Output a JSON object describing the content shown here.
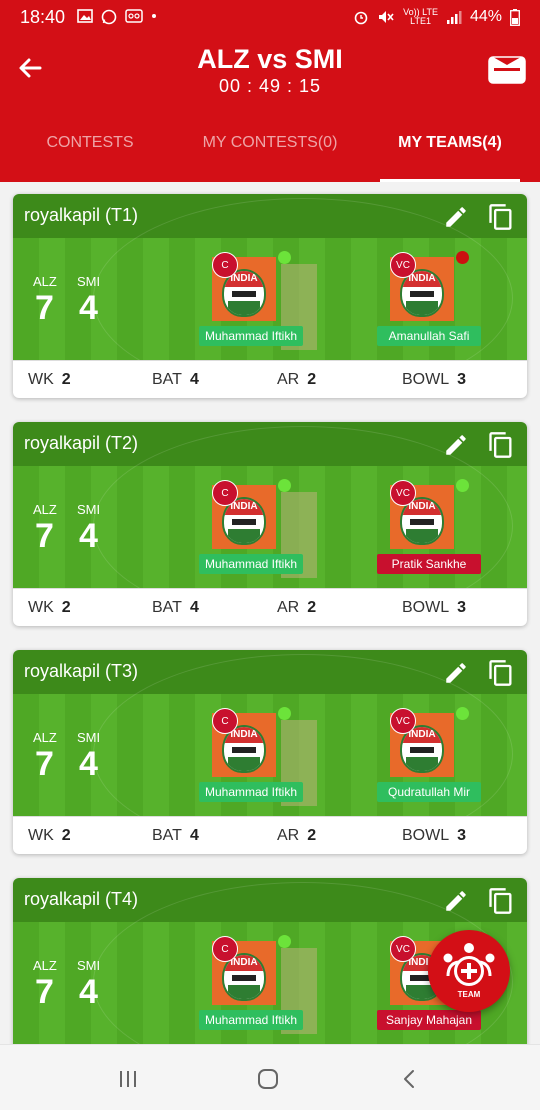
{
  "status_bar": {
    "time": "18:40",
    "network_top": "Vo)) LTE",
    "network_bottom": "LTE1",
    "battery": "44%"
  },
  "header": {
    "title": "ALZ vs SMI",
    "timer": "00 : 49 : 15"
  },
  "tabs": [
    {
      "label": "CONTESTS",
      "active": false
    },
    {
      "label": "MY CONTESTS(0)",
      "active": false
    },
    {
      "label": "MY TEAMS(4)",
      "active": true
    }
  ],
  "team_labels": {
    "team1": "ALZ",
    "team2": "SMI"
  },
  "stat_labels": {
    "wk": "WK",
    "bat": "BAT",
    "ar": "AR",
    "bowl": "BOWL"
  },
  "role_labels": {
    "captain": "C",
    "vice_captain": "VC"
  },
  "player_image_text": "INDIA",
  "teams": [
    {
      "name": "royalkapil (T1)",
      "team1_count": "7",
      "team2_count": "4",
      "captain": "Muhammad Iftikh",
      "captain_tag": "green",
      "captain_dot": "green",
      "vice_captain": "Amanullah Safi",
      "vice_tag": "green",
      "vice_dot": "red",
      "wk": "2",
      "bat": "4",
      "ar": "2",
      "bowl": "3"
    },
    {
      "name": "royalkapil (T2)",
      "team1_count": "7",
      "team2_count": "4",
      "captain": "Muhammad Iftikh",
      "captain_tag": "green",
      "captain_dot": "green",
      "vice_captain": "Pratik Sankhe",
      "vice_tag": "red",
      "vice_dot": "green",
      "wk": "2",
      "bat": "4",
      "ar": "2",
      "bowl": "3"
    },
    {
      "name": "royalkapil (T3)",
      "team1_count": "7",
      "team2_count": "4",
      "captain": "Muhammad Iftikh",
      "captain_tag": "green",
      "captain_dot": "green",
      "vice_captain": "Qudratullah Mir",
      "vice_tag": "green",
      "vice_dot": "green",
      "wk": "2",
      "bat": "4",
      "ar": "2",
      "bowl": "3"
    },
    {
      "name": "royalkapil (T4)",
      "team1_count": "7",
      "team2_count": "4",
      "captain": "Muhammad Iftikh",
      "captain_tag": "green",
      "captain_dot": "green",
      "vice_captain": "Sanjay Mahajan",
      "vice_tag": "red",
      "vice_dot": "green",
      "wk": "",
      "bat": "",
      "ar": "",
      "bowl": ""
    }
  ],
  "fab": {
    "label": "TEAM",
    "icon": "add-team-icon"
  },
  "colors": {
    "brand_red": "#d30f16",
    "pitch_green": "#4fa825",
    "card_header_green": "#3d8a1a",
    "tag_green": "#2fbe5e",
    "tag_red": "#c8102e"
  }
}
